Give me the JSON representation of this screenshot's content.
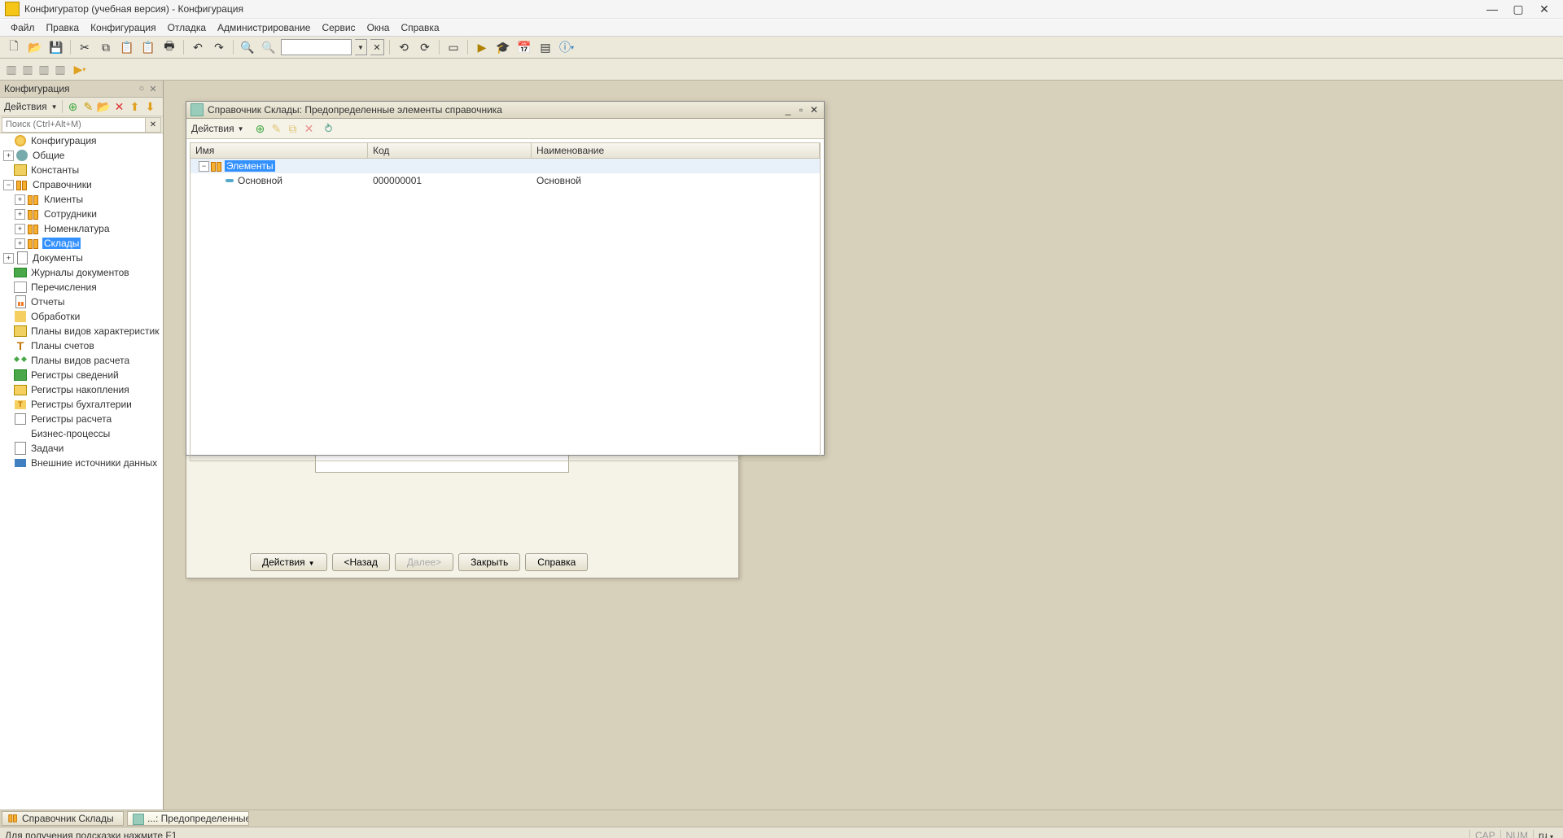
{
  "app": {
    "title": "Конфигуратор (учебная версия) - Конфигурация",
    "menu": [
      "Файл",
      "Правка",
      "Конфигурация",
      "Отладка",
      "Администрирование",
      "Сервис",
      "Окна",
      "Справка"
    ]
  },
  "config_panel": {
    "title": "Конфигурация",
    "actions_label": "Действия",
    "search_placeholder": "Поиск (Ctrl+Alt+M)",
    "tree": [
      {
        "indent": 0,
        "expander": "empty",
        "icon": "globe",
        "label": "Конфигурация"
      },
      {
        "indent": 0,
        "expander": "plus",
        "icon": "gear",
        "label": "Общие"
      },
      {
        "indent": 0,
        "expander": "empty",
        "icon": "table",
        "label": "Константы"
      },
      {
        "indent": 0,
        "expander": "minus",
        "icon": "catalog",
        "label": "Справочники"
      },
      {
        "indent": 1,
        "expander": "plus",
        "icon": "catalog",
        "label": "Клиенты"
      },
      {
        "indent": 1,
        "expander": "plus",
        "icon": "catalog",
        "label": "Сотрудники"
      },
      {
        "indent": 1,
        "expander": "plus",
        "icon": "catalog",
        "label": "Номенклатура"
      },
      {
        "indent": 1,
        "expander": "plus",
        "icon": "catalog",
        "label": "Склады",
        "selected": true
      },
      {
        "indent": 0,
        "expander": "plus",
        "icon": "doc",
        "label": "Документы"
      },
      {
        "indent": 0,
        "expander": "empty",
        "icon": "journal",
        "label": "Журналы документов"
      },
      {
        "indent": 0,
        "expander": "empty",
        "icon": "enum",
        "label": "Перечисления"
      },
      {
        "indent": 0,
        "expander": "empty",
        "icon": "report",
        "label": "Отчеты"
      },
      {
        "indent": 0,
        "expander": "empty",
        "icon": "process",
        "label": "Обработки"
      },
      {
        "indent": 0,
        "expander": "empty",
        "icon": "table",
        "label": "Планы видов характеристик"
      },
      {
        "indent": 0,
        "expander": "empty",
        "icon": "account",
        "label": "Планы счетов"
      },
      {
        "indent": 0,
        "expander": "empty",
        "icon": "calc",
        "label": "Планы видов расчета"
      },
      {
        "indent": 0,
        "expander": "empty",
        "icon": "register",
        "label": "Регистры сведений"
      },
      {
        "indent": 0,
        "expander": "empty",
        "icon": "accum",
        "label": "Регистры накопления"
      },
      {
        "indent": 0,
        "expander": "empty",
        "icon": "acc-reg",
        "label": "Регистры бухгалтерии"
      },
      {
        "indent": 0,
        "expander": "empty",
        "icon": "calc-reg",
        "label": "Регистры расчета"
      },
      {
        "indent": 0,
        "expander": "empty",
        "icon": "bizproc",
        "label": "Бизнес-процессы"
      },
      {
        "indent": 0,
        "expander": "empty",
        "icon": "task",
        "label": "Задачи"
      },
      {
        "indent": 0,
        "expander": "empty",
        "icon": "ext",
        "label": "Внешние источники данных"
      }
    ]
  },
  "under_window": {
    "actions_label": "Действия",
    "back_label": "<Назад",
    "next_label": "Далее>",
    "close_label": "Закрыть",
    "help_label": "Справка"
  },
  "child_window": {
    "title": "Справочник Склады: Предопределенные элементы справочника",
    "actions_label": "Действия",
    "columns": {
      "name": "Имя",
      "code": "Код",
      "desc": "Наименование"
    },
    "rows": [
      {
        "indent": 0,
        "expander": "minus",
        "icon": "catalog",
        "name": "Элементы",
        "code": "",
        "desc": "",
        "selected": true
      },
      {
        "indent": 1,
        "expander": "empty",
        "icon": "item",
        "name": "Основной",
        "code": "000000001",
        "desc": "Основной"
      }
    ]
  },
  "taskbar": {
    "tabs": [
      {
        "icon": "catalog",
        "label": "Справочник Склады",
        "active": false
      },
      {
        "icon": "predef",
        "label": "...: Предопределенные э...",
        "active": true
      }
    ]
  },
  "status_bar": {
    "hint": "Для получения подсказки нажмите F1",
    "cap": "CAP",
    "num": "NUM",
    "lang": "ru"
  }
}
